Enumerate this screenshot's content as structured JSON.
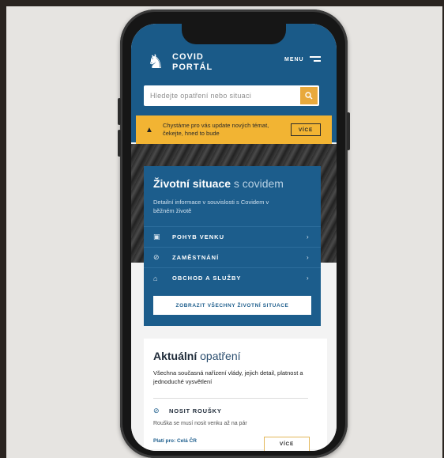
{
  "header": {
    "brand_line1": "COVID",
    "brand_line2": "PORTÁL",
    "menu_label": "MENU",
    "logo_icon": "lion-icon"
  },
  "search": {
    "placeholder": "Hledejte opatření nebo situaci",
    "icon": "search-icon"
  },
  "alert": {
    "text": "Chystáme pro vás update nových témat, čekejte, hned to bude",
    "button_label": "VÍCE",
    "icon": "warning-icon"
  },
  "life_situations": {
    "title_bold": "Životní situace",
    "title_light": "s covidem",
    "subtitle": "Detailní informace v souvislosti s Covidem v běžném životě",
    "items": [
      {
        "label": "POHYB VENKU",
        "icon": "bus-icon"
      },
      {
        "label": "ZAMĚSTNÁNÍ",
        "icon": "no-work-icon"
      },
      {
        "label": "OBCHOD A SLUŽBY",
        "icon": "shop-icon"
      }
    ],
    "show_all_label": "ZOBRAZIT VŠECHNY ŽIVOTNÍ SITUACE"
  },
  "current_measures": {
    "title_bold": "Aktuální",
    "title_light": "opatření",
    "description": "Všechna současná nařízení vlády, jejich detail, platnost a jednoduché vysvětlení",
    "measure": {
      "title": "NOSIT ROUŠKY",
      "icon": "mask-icon",
      "description": "Rouška se musí nosit venku až na pár",
      "validity": "Platí pro: Celá ČR",
      "button_label": "VÍCE"
    }
  },
  "colors": {
    "primary_blue": "#1a5a88",
    "accent_yellow": "#f2b433",
    "search_orange": "#e8a93c"
  }
}
